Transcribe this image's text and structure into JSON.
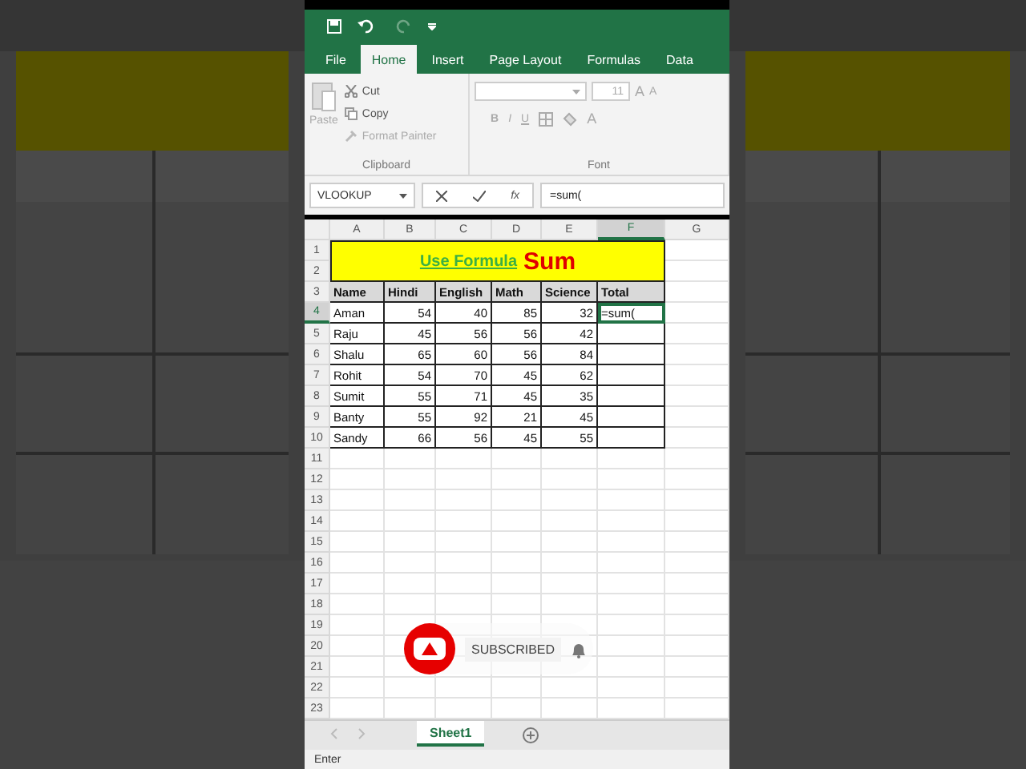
{
  "ribbon_tabs": [
    {
      "label": "File",
      "selected": false
    },
    {
      "label": "Home",
      "selected": true
    },
    {
      "label": "Insert",
      "selected": false
    },
    {
      "label": "Page Layout",
      "selected": false
    },
    {
      "label": "Formulas",
      "selected": false
    },
    {
      "label": "Data",
      "selected": false
    }
  ],
  "clipboard": {
    "paste": "Paste",
    "cut": "Cut",
    "copy": "Copy",
    "format_painter": "Format Painter",
    "group_label": "Clipboard"
  },
  "font": {
    "font_size": "11",
    "grow": "A",
    "shrink": "A",
    "styles": [
      "B",
      "I",
      "U"
    ],
    "color_button": "A",
    "group_label": "Font"
  },
  "formula_bar": {
    "name_box": "VLOOKUP",
    "fx": "fx",
    "formula": "=sum("
  },
  "sheet": {
    "columns": [
      {
        "label": "A",
        "selected": false
      },
      {
        "label": "B",
        "selected": false
      },
      {
        "label": "C",
        "selected": false
      },
      {
        "label": "D",
        "selected": false
      },
      {
        "label": "E",
        "selected": false
      },
      {
        "label": "F",
        "selected": true
      },
      {
        "label": "G",
        "selected": false
      }
    ],
    "row_numbers": [
      {
        "label": "1",
        "selected": false
      },
      {
        "label": "2",
        "selected": false
      },
      {
        "label": "3",
        "selected": false
      },
      {
        "label": "4",
        "selected": true
      },
      {
        "label": "5",
        "selected": false
      },
      {
        "label": "6",
        "selected": false
      },
      {
        "label": "7",
        "selected": false
      },
      {
        "label": "8",
        "selected": false
      },
      {
        "label": "9",
        "selected": false
      },
      {
        "label": "10",
        "selected": false
      },
      {
        "label": "11",
        "selected": false
      },
      {
        "label": "12",
        "selected": false
      },
      {
        "label": "13",
        "selected": false
      },
      {
        "label": "14",
        "selected": false
      },
      {
        "label": "15",
        "selected": false
      },
      {
        "label": "16",
        "selected": false
      },
      {
        "label": "17",
        "selected": false
      },
      {
        "label": "18",
        "selected": false
      },
      {
        "label": "19",
        "selected": false
      },
      {
        "label": "20",
        "selected": false
      },
      {
        "label": "21",
        "selected": false
      },
      {
        "label": "22",
        "selected": false
      },
      {
        "label": "23",
        "selected": false
      }
    ],
    "title": {
      "text": "Use Formula",
      "emphasis": "Sum"
    },
    "headers": [
      "Name",
      "Hindi",
      "English",
      "Math",
      "Science",
      "Total"
    ],
    "rows": [
      {
        "name": "Aman",
        "values": [
          "54",
          "40",
          "85",
          "32"
        ],
        "total": "=sum(",
        "selected": true
      },
      {
        "name": "Raju",
        "values": [
          "45",
          "56",
          "56",
          "42"
        ],
        "selected": false
      },
      {
        "name": "Shalu",
        "values": [
          "65",
          "60",
          "56",
          "84"
        ],
        "selected": false
      },
      {
        "name": "Rohit",
        "values": [
          "54",
          "70",
          "45",
          "62"
        ],
        "selected": false
      },
      {
        "name": "Sumit",
        "values": [
          "55",
          "71",
          "45",
          "35"
        ],
        "selected": false
      },
      {
        "name": "Banty",
        "values": [
          "55",
          "92",
          "21",
          "45"
        ],
        "selected": false
      },
      {
        "name": "Sandy",
        "values": [
          "66",
          "56",
          "45",
          "55"
        ],
        "selected": false
      }
    ]
  },
  "overlay": {
    "label": "SUBSCRIBED"
  },
  "sheet_tabs": [
    {
      "label": "Sheet1",
      "selected": true
    }
  ],
  "status": "Enter"
}
